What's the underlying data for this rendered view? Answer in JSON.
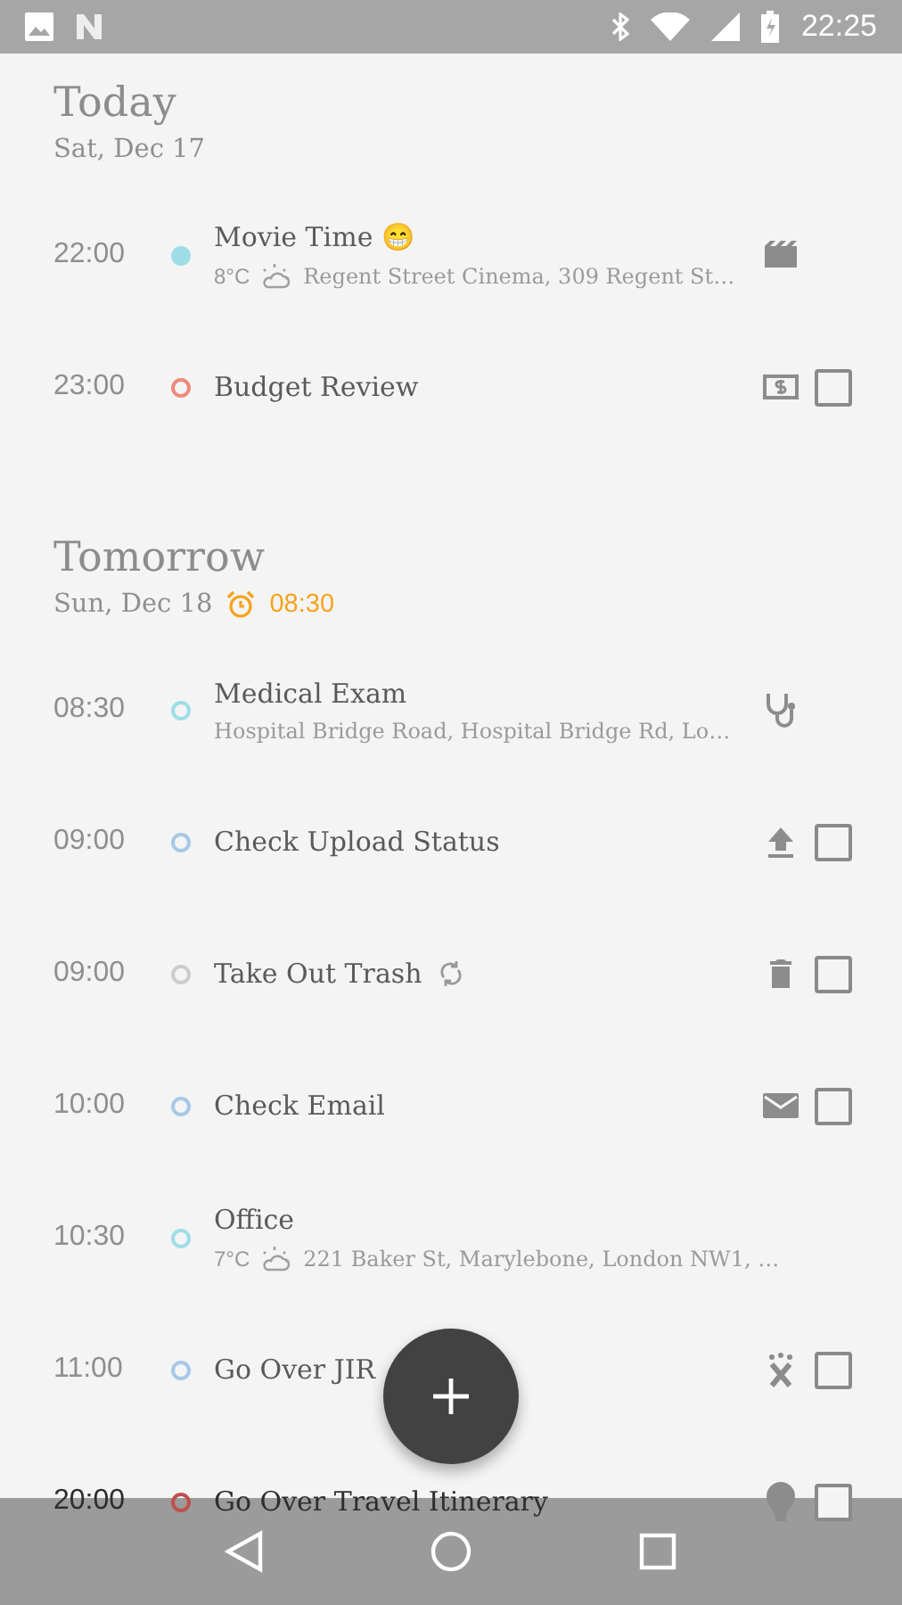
{
  "status_bar": {
    "time": "22:25"
  },
  "sections": [
    {
      "title": "Today",
      "date": "Sat, Dec 17",
      "rows": [
        {
          "time": "22:00",
          "color": "#9fdde6",
          "filled": true,
          "title": "Movie Time 😁",
          "temp": "8°C",
          "location": "Regent Street Cinema, 309 Regent St…"
        },
        {
          "time": "23:00",
          "color": "#f08a7a",
          "filled": false,
          "title": "Budget Review",
          "checked": false
        }
      ]
    },
    {
      "title": "Tomorrow",
      "date": "Sun, Dec 18",
      "alarm": "08:30",
      "rows": [
        {
          "time": "08:30",
          "color": "#9fdde6",
          "filled": false,
          "title": "Medical Exam",
          "location": "Hospital Bridge Road, Hospital Bridge Rd, Lo…"
        },
        {
          "time": "09:00",
          "color": "#a7c8e8",
          "filled": false,
          "title": "Check Upload Status",
          "checked": false
        },
        {
          "time": "09:00",
          "color": "#cccccc",
          "filled": false,
          "title": "Take Out Trash",
          "repeating": true,
          "checked": false
        },
        {
          "time": "10:00",
          "color": "#a7c8e8",
          "filled": false,
          "title": "Check Email",
          "checked": false
        },
        {
          "time": "10:30",
          "color": "#9fdde6",
          "filled": false,
          "title": "Office",
          "temp": "7°C",
          "location": "221 Baker St, Marylebone, London NW1, …"
        },
        {
          "time": "11:00",
          "color": "#a7c8e8",
          "filled": false,
          "title": "Go Over JIR",
          "checked": false
        },
        {
          "time": "20:00",
          "color": "#c0504d",
          "filled": false,
          "title": "Go Over Travel Itinerary",
          "checked": false
        }
      ]
    }
  ]
}
